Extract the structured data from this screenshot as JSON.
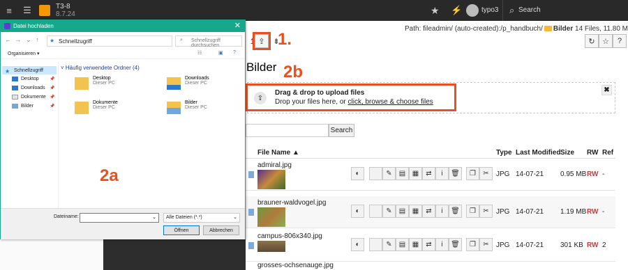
{
  "topbar": {
    "site_name": "T3-8",
    "version": "8.7.24",
    "username": "typo3",
    "search_label": "Search"
  },
  "docheader": {
    "path_label": "Path: fileadmin/ (auto-created):/p_handbuch/",
    "current_folder": "Bilder",
    "folder_info": "14 Files, 11.80 MB"
  },
  "annotations": {
    "step1": "1.",
    "step2a": "2a",
    "step2b": "2b"
  },
  "page_title": "Bilder",
  "dropzone": {
    "title": "Drag & drop to upload files",
    "text_prefix": "Drop your files here, or ",
    "link": "click, browse & choose files",
    "close": "✖"
  },
  "filter": {
    "search_button": "Search"
  },
  "table": {
    "headers": {
      "name": "File Name",
      "type": "Type",
      "modified": "Last Modified",
      "size": "Size",
      "rw": "RW",
      "ref": "Ref"
    },
    "rows": [
      {
        "name": "admiral.jpg",
        "type": "JPG",
        "modified": "14-07-21",
        "size": "0.95 MB",
        "rw": "RW",
        "ref": "-"
      },
      {
        "name": "brauner-waldvogel.jpg",
        "type": "JPG",
        "modified": "14-07-21",
        "size": "1.19 MB",
        "rw": "RW",
        "ref": "-"
      },
      {
        "name": "campus-806x340.jpg",
        "type": "JPG",
        "modified": "14-07-21",
        "size": "301 KB",
        "rw": "RW",
        "ref": "2"
      },
      {
        "name": "grosses-ochsenauge.jpg",
        "type": "",
        "modified": "",
        "size": "",
        "rw": "",
        "ref": ""
      }
    ]
  },
  "dialog": {
    "title": "Datei hochladen",
    "address": "Schnellzugriff",
    "search_placeholder": "Schnellzugriff durchsuchen",
    "organize": "Organisieren ▾",
    "sidebar": [
      {
        "label": "Schnellzugriff"
      },
      {
        "label": "Desktop"
      },
      {
        "label": "Downloads"
      },
      {
        "label": "Dokumente"
      },
      {
        "label": "Bilder"
      }
    ],
    "group_title": "Häufig verwendete Ordner (4)",
    "folders": [
      {
        "name": "Desktop",
        "sub": "Dieser PC"
      },
      {
        "name": "Downloads",
        "sub": "Dieser PC"
      },
      {
        "name": "Dokumente",
        "sub": "Dieser PC"
      },
      {
        "name": "Bilder",
        "sub": "Dieser PC"
      }
    ],
    "filename_label": "Dateiname:",
    "filetype": "Alle Dateien (*.*)",
    "open_button": "Öffnen",
    "cancel_button": "Abbrechen"
  },
  "colors": {
    "accent": "#e8511f",
    "dialog_titlebar": "#17a88b",
    "topbar": "#292929",
    "rw": "#c83c3c"
  }
}
